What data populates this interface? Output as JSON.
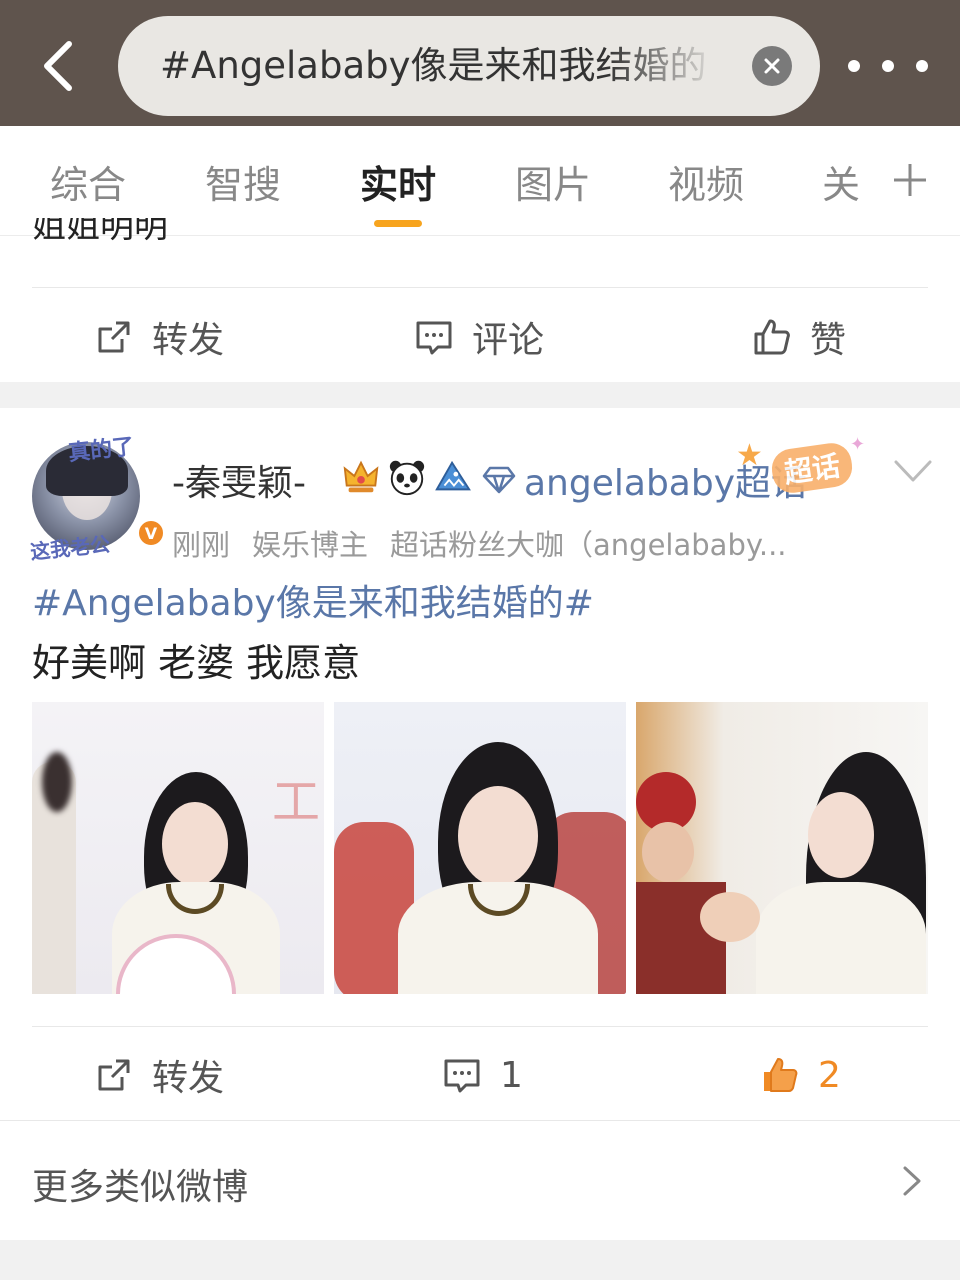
{
  "search": {
    "query": "#Angelababy像是来和我结婚的"
  },
  "tabs": [
    {
      "label": "综合",
      "active": false
    },
    {
      "label": "智搜",
      "active": false
    },
    {
      "label": "实时",
      "active": true
    },
    {
      "label": "图片",
      "active": false
    },
    {
      "label": "视频",
      "active": false
    },
    {
      "label": "关",
      "active": false
    }
  ],
  "previous_post": {
    "text_fragment": "姐姐明明",
    "actions": {
      "repost_label": "转发",
      "comment_label": "评论",
      "like_label": "赞"
    }
  },
  "post": {
    "avatar_frame_top": "真的了",
    "avatar_frame_bottom": "这我老公",
    "username": "-秦雯颖-",
    "badge_icons": [
      "crown-icon",
      "panda-icon",
      "shark-icon"
    ],
    "supertopic_label": "angelababy超话",
    "supertopic_badge_label": "超话",
    "meta": [
      "刚刚",
      "娱乐博主",
      "超话粉丝大咖（angelababy..."
    ],
    "hashtag": "#Angelababy像是来和我结婚的#",
    "body": "好美啊 老婆 我愿意",
    "photo_count": 3,
    "actions": {
      "repost_label": "转发",
      "comment_count": "1",
      "like_count": "2"
    }
  },
  "more_similar_label": "更多类似微博",
  "colors": {
    "topbar": "#5f544d",
    "accent": "#f7a41e",
    "link": "#5a77a8",
    "like_active": "#f08a24"
  }
}
